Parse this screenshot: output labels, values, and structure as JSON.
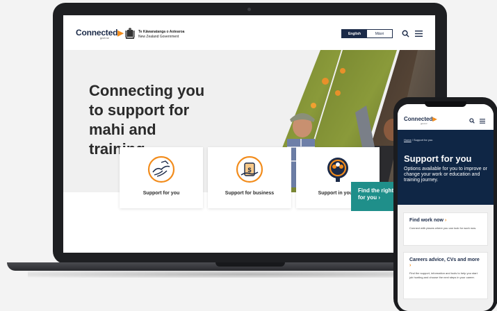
{
  "header": {
    "brand": "Connected",
    "brand_sub": "govt.nz",
    "gov_name_1": "Te Kāwanatanga o Aotearoa",
    "gov_name_2": "New Zealand Government",
    "lang_english": "English",
    "lang_maori": "Māori",
    "icons": {
      "search": "search-icon",
      "menu": "menu-icon"
    }
  },
  "hero": {
    "title_lines": [
      "Connecting you",
      "to support for",
      "mahi and",
      "training"
    ]
  },
  "cards": [
    {
      "label": "Support for you",
      "icon": "helping-hands-icon"
    },
    {
      "label": "Support for business",
      "icon": "business-support-icon"
    },
    {
      "label": "Support in your r",
      "icon": "community-search-icon"
    }
  ],
  "cta": {
    "line1": "Find the right",
    "line2": "for you ›"
  },
  "mobile": {
    "brand": "Connected",
    "brand_sub": "govt.nz",
    "breadcrumb_home": "Home",
    "breadcrumb_sep": " / ",
    "breadcrumb_current": "Support for you",
    "title": "Support for you",
    "description": "Options available for you to improve or change your work or education and training journey.",
    "cards": [
      {
        "title": "Find work now",
        "desc": "Connect with places where you can look for work now."
      },
      {
        "title": "Careers advice, CVs and more",
        "desc": "Find the support, information and tools to help you start job hunting and choose the next steps in your career."
      }
    ]
  },
  "colors": {
    "navy": "#1b2a48",
    "hero_navy": "#0f2645",
    "accent_orange": "#f28c1c",
    "teal": "#1f8f8a"
  }
}
